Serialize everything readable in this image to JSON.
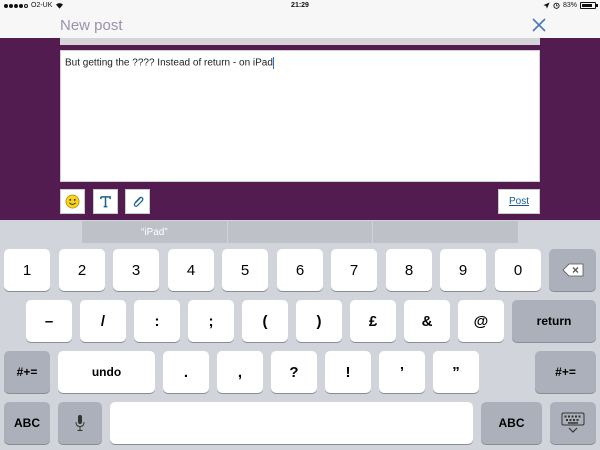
{
  "status": {
    "carrier": "O2-UK",
    "time": "21:29",
    "battery": "83%",
    "battery_level": 0.83
  },
  "nav": {
    "title": "New post"
  },
  "editor": {
    "text": "But getting the ???? Instead of return - on iPad"
  },
  "toolbar": {
    "post_label": "Post"
  },
  "suggestions": [
    "“iPad”",
    "",
    ""
  ],
  "keyboard": {
    "row1": [
      "1",
      "2",
      "3",
      "4",
      "5",
      "6",
      "7",
      "8",
      "9",
      "0"
    ],
    "row2": [
      "–",
      "/",
      ":",
      ";",
      "(",
      ")",
      "£",
      "&",
      "@"
    ],
    "return_label": "return",
    "row3_left": "#+=",
    "undo_label": "undo",
    "row3": [
      ".",
      ",",
      "?",
      "!",
      "’",
      "”"
    ],
    "row3_right": "#+=",
    "abc_left": "ABC",
    "abc_right": "ABC"
  }
}
